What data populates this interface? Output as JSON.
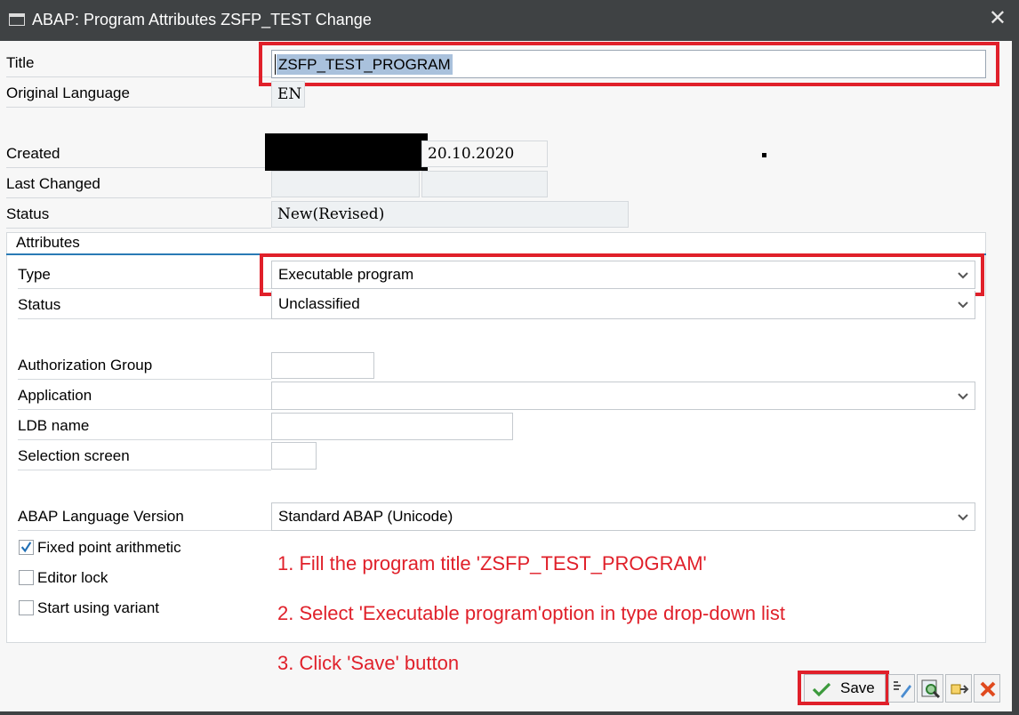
{
  "window": {
    "title": "ABAP: Program Attributes ZSFP_TEST Change"
  },
  "fields": {
    "title_label": "Title",
    "title_value": "ZSFP_TEST_PROGRAM",
    "orig_lang_label": "Original Language",
    "orig_lang_value": "EN",
    "created_label": "Created",
    "created_date": "20.10.2020",
    "last_changed_label": "Last Changed",
    "status_label": "Status",
    "status_value": "New(Revised)"
  },
  "attributes": {
    "group_title": "Attributes",
    "type_label": "Type",
    "type_value": "Executable program",
    "status_label": "Status",
    "status_value": "Unclassified",
    "auth_group_label": "Authorization Group",
    "application_label": "Application",
    "ldb_label": "LDB name",
    "selection_screen_label": "Selection screen",
    "abap_version_label": "ABAP Language Version",
    "abap_version_value": "Standard ABAP (Unicode)",
    "checkboxes": [
      {
        "label": "Fixed point arithmetic",
        "checked": true
      },
      {
        "label": "Editor lock",
        "checked": false
      },
      {
        "label": "Start using variant",
        "checked": false
      }
    ]
  },
  "notes": [
    "1. Fill the program title 'ZSFP_TEST_PROGRAM'",
    "2. Select 'Executable program'option in type drop-down list",
    "3. Click 'Save' button"
  ],
  "toolbar": {
    "save_label": "Save"
  },
  "colors": {
    "annotation": "#e0202a",
    "titlebar": "#3f4244",
    "accent_line": "#2a7ab5"
  }
}
